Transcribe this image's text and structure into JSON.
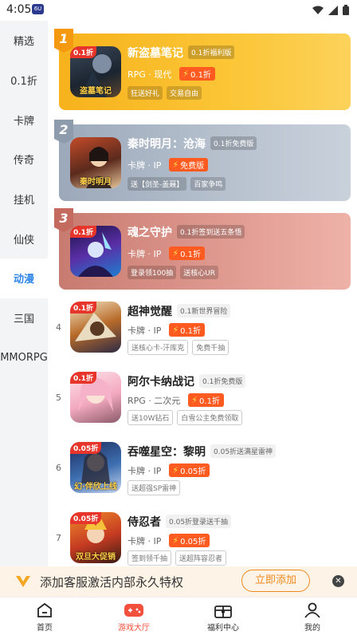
{
  "status": {
    "time": "4:05",
    "app_badge": "6U"
  },
  "sidebar": {
    "items": [
      {
        "label": "精选"
      },
      {
        "label": "0.1折"
      },
      {
        "label": "卡牌"
      },
      {
        "label": "传奇"
      },
      {
        "label": "挂机"
      },
      {
        "label": "仙侠"
      },
      {
        "label": "动漫"
      },
      {
        "label": "三国"
      },
      {
        "label": "MMORPG"
      }
    ],
    "active_index": 6
  },
  "featured": [
    {
      "rank": "1",
      "name": "新盗墓笔记",
      "pill": "0.1折福利版",
      "genre": "RPG · 现代",
      "discount": "0.1折",
      "tags": [
        "狂送好礼",
        "交易自由"
      ],
      "corner": "0.1折",
      "banner": "盗墓笔记",
      "accent": "#f7b21c"
    },
    {
      "rank": "2",
      "name": "秦时明月：沧海",
      "pill": "0.1折免费版",
      "genre": "卡牌 · IP",
      "discount": "免费版",
      "tags": [
        "送【剑圣-盖聂】",
        "百家争鸣"
      ],
      "corner": "",
      "banner": "秦时明月",
      "accent": "#9ca9ba"
    },
    {
      "rank": "3",
      "name": "魂之守护",
      "pill": "0.1折签到送五条悟",
      "genre": "卡牌 · IP",
      "discount": "0.1折",
      "tags": [
        "登录领100抽",
        "送核心UR"
      ],
      "corner": "0.1折",
      "banner": "",
      "accent": "#c87b70"
    }
  ],
  "list": [
    {
      "rank": "4",
      "name": "超神觉醒",
      "pill": "0.1新世界冒险",
      "genre": "卡牌 · IP",
      "discount": "0.1折",
      "tags": [
        "送核心卡-汗库克",
        "免费千抽"
      ],
      "corner": "0.1折",
      "banner": ""
    },
    {
      "rank": "5",
      "name": "阿尔卡纳战记",
      "pill": "0.1折免费版",
      "genre": "RPG · 二次元",
      "discount": "0.1折",
      "tags": [
        "送10W钻石",
        "白雪公主免费领取"
      ],
      "corner": "0.1折",
      "banner": ""
    },
    {
      "rank": "6",
      "name": "吞噬星空：黎明",
      "pill": "0.05折送满星雷神",
      "genre": "卡牌 · IP",
      "discount": "0.05折",
      "tags": [
        "送超强SP雷神"
      ],
      "corner": "0.05折",
      "banner": "幻·伴欣上线"
    },
    {
      "rank": "7",
      "name": "侍忍者",
      "pill": "0.05折登录送千抽",
      "genre": "卡牌 · IP",
      "discount": "0.05折",
      "tags": [
        "签到领千抽",
        "送超阵容忍者"
      ],
      "corner": "0.05折",
      "banner": "双旦大促销"
    }
  ],
  "promo": {
    "text": "添加客服激活内部永久特权",
    "button": "立即添加"
  },
  "bottom_nav": [
    {
      "label": "首页",
      "icon": "home-icon"
    },
    {
      "label": "游戏大厅",
      "icon": "gamepad-icon",
      "active": true
    },
    {
      "label": "福利中心",
      "icon": "gift-box-icon"
    },
    {
      "label": "我的",
      "icon": "user-icon"
    }
  ]
}
